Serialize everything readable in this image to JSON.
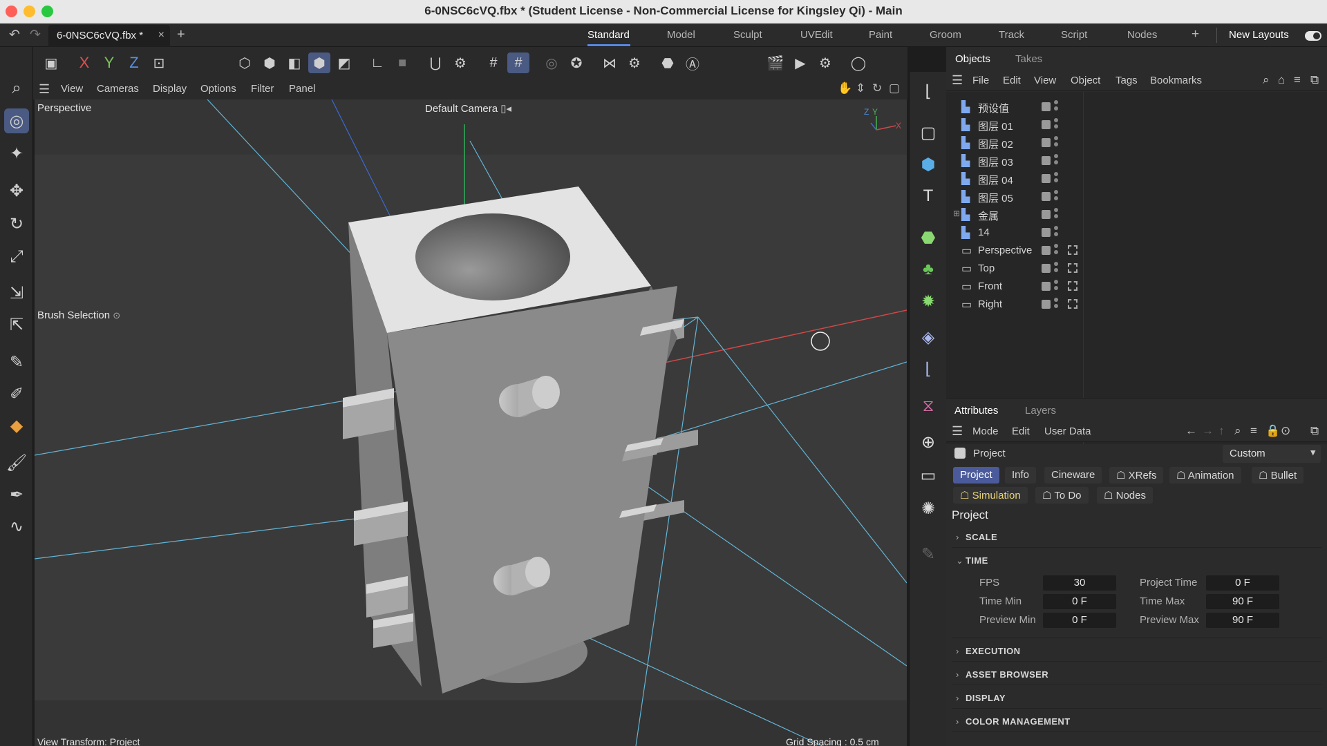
{
  "window": {
    "title": "6-0NSC6cVQ.fbx * (Student License - Non-Commercial License for Kingsley Qi) - Main"
  },
  "tabbar": {
    "doc_tab": "6-0NSC6cVQ.fbx *",
    "close": "×",
    "add": "+",
    "layouts": [
      "Standard",
      "Model",
      "Sculpt",
      "UVEdit",
      "Paint",
      "Groom",
      "Track",
      "Script",
      "Nodes"
    ],
    "add_layout": "+",
    "new_layouts": "New Layouts"
  },
  "toolbar": {
    "x": "X",
    "y": "Y",
    "z": "Z"
  },
  "viewport_menu": {
    "items": [
      "View",
      "Cameras",
      "Display",
      "Options",
      "Filter",
      "Panel"
    ]
  },
  "viewport": {
    "view_name": "Perspective",
    "camera": "Default Camera",
    "tool_label": "Brush Selection",
    "view_transform": "View Transform: Project",
    "grid_spacing": "Grid Spacing : 0.5 cm",
    "axis_labels": {
      "z": "Z",
      "y": "Y",
      "x": "X"
    }
  },
  "objects_panel": {
    "tabs": [
      "Objects",
      "Takes"
    ],
    "menu": [
      "File",
      "Edit",
      "View",
      "Object",
      "Tags",
      "Bookmarks"
    ],
    "rows": [
      {
        "name": "预设值",
        "type": "layer"
      },
      {
        "name": "图层 01",
        "type": "layer"
      },
      {
        "name": "图层 02",
        "type": "layer"
      },
      {
        "name": "图层 03",
        "type": "layer"
      },
      {
        "name": "图层 04",
        "type": "layer"
      },
      {
        "name": "图层 05",
        "type": "layer"
      },
      {
        "name": "金属",
        "type": "layer",
        "expandable": true
      },
      {
        "name": "14",
        "type": "layer"
      },
      {
        "name": "Perspective",
        "type": "camera"
      },
      {
        "name": "Top",
        "type": "camera"
      },
      {
        "name": "Front",
        "type": "camera"
      },
      {
        "name": "Right",
        "type": "camera"
      }
    ]
  },
  "attributes_panel": {
    "tabs": [
      "Attributes",
      "Layers"
    ],
    "menu": [
      "Mode",
      "Edit",
      "User Data"
    ],
    "object": "Project",
    "mode_select": "Custom",
    "chips_row1": [
      "Project",
      "Info",
      "Cineware",
      "XRefs",
      "Animation",
      "Bullet"
    ],
    "chips_row2": [
      "Simulation",
      "To Do",
      "Nodes"
    ],
    "section_title": "Project",
    "groups": {
      "scale": "SCALE",
      "time": "TIME",
      "execution": "EXECUTION",
      "asset_browser": "ASSET BROWSER",
      "display": "DISPLAY",
      "color_management": "COLOR MANAGEMENT"
    },
    "time_fields": {
      "fps_label": "FPS",
      "fps": "30",
      "project_time_label": "Project Time",
      "project_time": "0 F",
      "time_min_label": "Time Min",
      "time_min": "0 F",
      "time_max_label": "Time Max",
      "time_max": "90 F",
      "preview_min_label": "Preview Min",
      "preview_min": "0 F",
      "preview_max_label": "Preview Max",
      "preview_max": "90 F"
    }
  },
  "colors": {
    "accent": "#4a5a82",
    "active_chip": "#4a5a9a",
    "x_axis": "#e05050",
    "y_axis": "#7cc25a",
    "z_axis": "#5a8fe0"
  }
}
